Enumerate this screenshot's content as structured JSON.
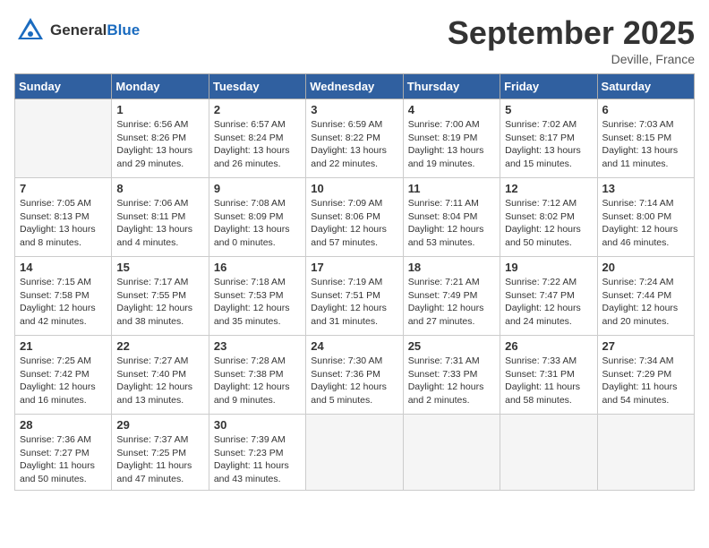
{
  "header": {
    "logo_general": "General",
    "logo_blue": "Blue",
    "month": "September 2025",
    "location": "Deville, France"
  },
  "weekdays": [
    "Sunday",
    "Monday",
    "Tuesday",
    "Wednesday",
    "Thursday",
    "Friday",
    "Saturday"
  ],
  "weeks": [
    [
      {
        "day": "",
        "info": null
      },
      {
        "day": "1",
        "sunrise": "Sunrise: 6:56 AM",
        "sunset": "Sunset: 8:26 PM",
        "daylight": "Daylight: 13 hours and 29 minutes."
      },
      {
        "day": "2",
        "sunrise": "Sunrise: 6:57 AM",
        "sunset": "Sunset: 8:24 PM",
        "daylight": "Daylight: 13 hours and 26 minutes."
      },
      {
        "day": "3",
        "sunrise": "Sunrise: 6:59 AM",
        "sunset": "Sunset: 8:22 PM",
        "daylight": "Daylight: 13 hours and 22 minutes."
      },
      {
        "day": "4",
        "sunrise": "Sunrise: 7:00 AM",
        "sunset": "Sunset: 8:19 PM",
        "daylight": "Daylight: 13 hours and 19 minutes."
      },
      {
        "day": "5",
        "sunrise": "Sunrise: 7:02 AM",
        "sunset": "Sunset: 8:17 PM",
        "daylight": "Daylight: 13 hours and 15 minutes."
      },
      {
        "day": "6",
        "sunrise": "Sunrise: 7:03 AM",
        "sunset": "Sunset: 8:15 PM",
        "daylight": "Daylight: 13 hours and 11 minutes."
      }
    ],
    [
      {
        "day": "7",
        "sunrise": "Sunrise: 7:05 AM",
        "sunset": "Sunset: 8:13 PM",
        "daylight": "Daylight: 13 hours and 8 minutes."
      },
      {
        "day": "8",
        "sunrise": "Sunrise: 7:06 AM",
        "sunset": "Sunset: 8:11 PM",
        "daylight": "Daylight: 13 hours and 4 minutes."
      },
      {
        "day": "9",
        "sunrise": "Sunrise: 7:08 AM",
        "sunset": "Sunset: 8:09 PM",
        "daylight": "Daylight: 13 hours and 0 minutes."
      },
      {
        "day": "10",
        "sunrise": "Sunrise: 7:09 AM",
        "sunset": "Sunset: 8:06 PM",
        "daylight": "Daylight: 12 hours and 57 minutes."
      },
      {
        "day": "11",
        "sunrise": "Sunrise: 7:11 AM",
        "sunset": "Sunset: 8:04 PM",
        "daylight": "Daylight: 12 hours and 53 minutes."
      },
      {
        "day": "12",
        "sunrise": "Sunrise: 7:12 AM",
        "sunset": "Sunset: 8:02 PM",
        "daylight": "Daylight: 12 hours and 50 minutes."
      },
      {
        "day": "13",
        "sunrise": "Sunrise: 7:14 AM",
        "sunset": "Sunset: 8:00 PM",
        "daylight": "Daylight: 12 hours and 46 minutes."
      }
    ],
    [
      {
        "day": "14",
        "sunrise": "Sunrise: 7:15 AM",
        "sunset": "Sunset: 7:58 PM",
        "daylight": "Daylight: 12 hours and 42 minutes."
      },
      {
        "day": "15",
        "sunrise": "Sunrise: 7:17 AM",
        "sunset": "Sunset: 7:55 PM",
        "daylight": "Daylight: 12 hours and 38 minutes."
      },
      {
        "day": "16",
        "sunrise": "Sunrise: 7:18 AM",
        "sunset": "Sunset: 7:53 PM",
        "daylight": "Daylight: 12 hours and 35 minutes."
      },
      {
        "day": "17",
        "sunrise": "Sunrise: 7:19 AM",
        "sunset": "Sunset: 7:51 PM",
        "daylight": "Daylight: 12 hours and 31 minutes."
      },
      {
        "day": "18",
        "sunrise": "Sunrise: 7:21 AM",
        "sunset": "Sunset: 7:49 PM",
        "daylight": "Daylight: 12 hours and 27 minutes."
      },
      {
        "day": "19",
        "sunrise": "Sunrise: 7:22 AM",
        "sunset": "Sunset: 7:47 PM",
        "daylight": "Daylight: 12 hours and 24 minutes."
      },
      {
        "day": "20",
        "sunrise": "Sunrise: 7:24 AM",
        "sunset": "Sunset: 7:44 PM",
        "daylight": "Daylight: 12 hours and 20 minutes."
      }
    ],
    [
      {
        "day": "21",
        "sunrise": "Sunrise: 7:25 AM",
        "sunset": "Sunset: 7:42 PM",
        "daylight": "Daylight: 12 hours and 16 minutes."
      },
      {
        "day": "22",
        "sunrise": "Sunrise: 7:27 AM",
        "sunset": "Sunset: 7:40 PM",
        "daylight": "Daylight: 12 hours and 13 minutes."
      },
      {
        "day": "23",
        "sunrise": "Sunrise: 7:28 AM",
        "sunset": "Sunset: 7:38 PM",
        "daylight": "Daylight: 12 hours and 9 minutes."
      },
      {
        "day": "24",
        "sunrise": "Sunrise: 7:30 AM",
        "sunset": "Sunset: 7:36 PM",
        "daylight": "Daylight: 12 hours and 5 minutes."
      },
      {
        "day": "25",
        "sunrise": "Sunrise: 7:31 AM",
        "sunset": "Sunset: 7:33 PM",
        "daylight": "Daylight: 12 hours and 2 minutes."
      },
      {
        "day": "26",
        "sunrise": "Sunrise: 7:33 AM",
        "sunset": "Sunset: 7:31 PM",
        "daylight": "Daylight: 11 hours and 58 minutes."
      },
      {
        "day": "27",
        "sunrise": "Sunrise: 7:34 AM",
        "sunset": "Sunset: 7:29 PM",
        "daylight": "Daylight: 11 hours and 54 minutes."
      }
    ],
    [
      {
        "day": "28",
        "sunrise": "Sunrise: 7:36 AM",
        "sunset": "Sunset: 7:27 PM",
        "daylight": "Daylight: 11 hours and 50 minutes."
      },
      {
        "day": "29",
        "sunrise": "Sunrise: 7:37 AM",
        "sunset": "Sunset: 7:25 PM",
        "daylight": "Daylight: 11 hours and 47 minutes."
      },
      {
        "day": "30",
        "sunrise": "Sunrise: 7:39 AM",
        "sunset": "Sunset: 7:23 PM",
        "daylight": "Daylight: 11 hours and 43 minutes."
      },
      {
        "day": "",
        "info": null
      },
      {
        "day": "",
        "info": null
      },
      {
        "day": "",
        "info": null
      },
      {
        "day": "",
        "info": null
      }
    ]
  ]
}
